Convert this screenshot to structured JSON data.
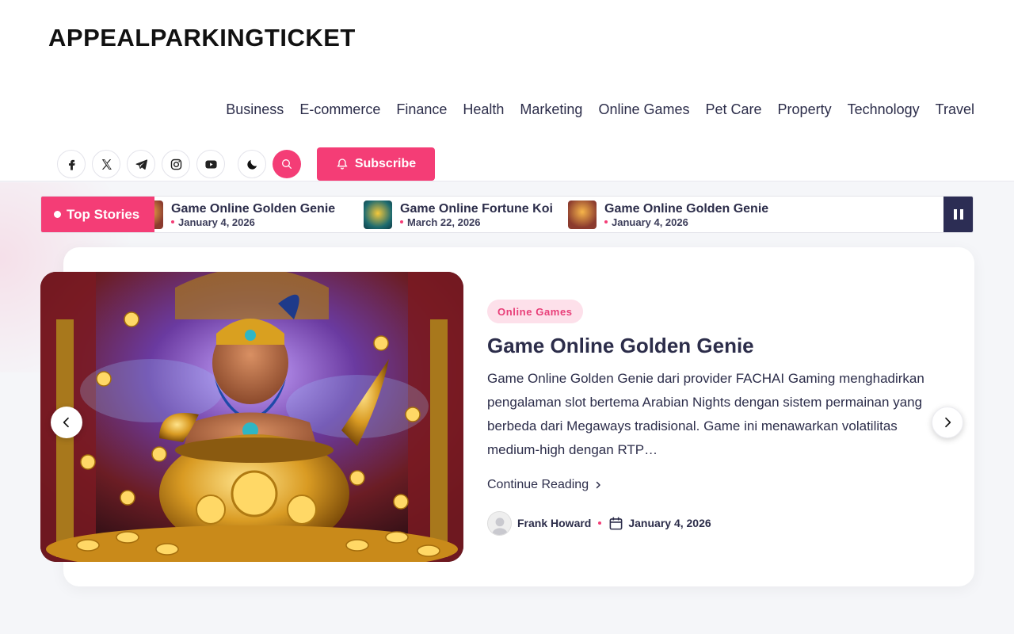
{
  "site": {
    "brand": "APPEALPARKINGTICKET"
  },
  "nav": [
    "Business",
    "E-commerce",
    "Finance",
    "Health",
    "Marketing",
    "Online Games",
    "Pet Care",
    "Property",
    "Technology",
    "Travel"
  ],
  "social": [
    "facebook-icon",
    "x-icon",
    "telegram-icon",
    "instagram-icon",
    "youtube-icon"
  ],
  "actions": {
    "subscribe_label": "Subscribe"
  },
  "ticker": {
    "label": "Top Stories",
    "items": [
      {
        "title": "Game Online Golden Genie",
        "date": "January 4, 2026"
      },
      {
        "title": "Game Online Fortune Koi",
        "date": "March 22, 2026"
      },
      {
        "title": "Game Online Golden Genie",
        "date": "January 4, 2026"
      }
    ]
  },
  "featured": {
    "category": "Online Games",
    "title": "Game Online Golden Genie",
    "excerpt": "  Game Online Golden Genie dari provider FACHAI Gaming menghadirkan pengalaman slot bertema Arabian Nights dengan sistem permainan yang berbeda dari Megaways tradisional. Game ini menawarkan volatilitas medium-high dengan RTP…",
    "read_more": "Continue Reading",
    "author": "Frank Howard",
    "date": "January 4, 2026"
  },
  "colors": {
    "accent": "#f43d76",
    "dark": "#2c2d54",
    "category_bg": "#fde0ea"
  }
}
